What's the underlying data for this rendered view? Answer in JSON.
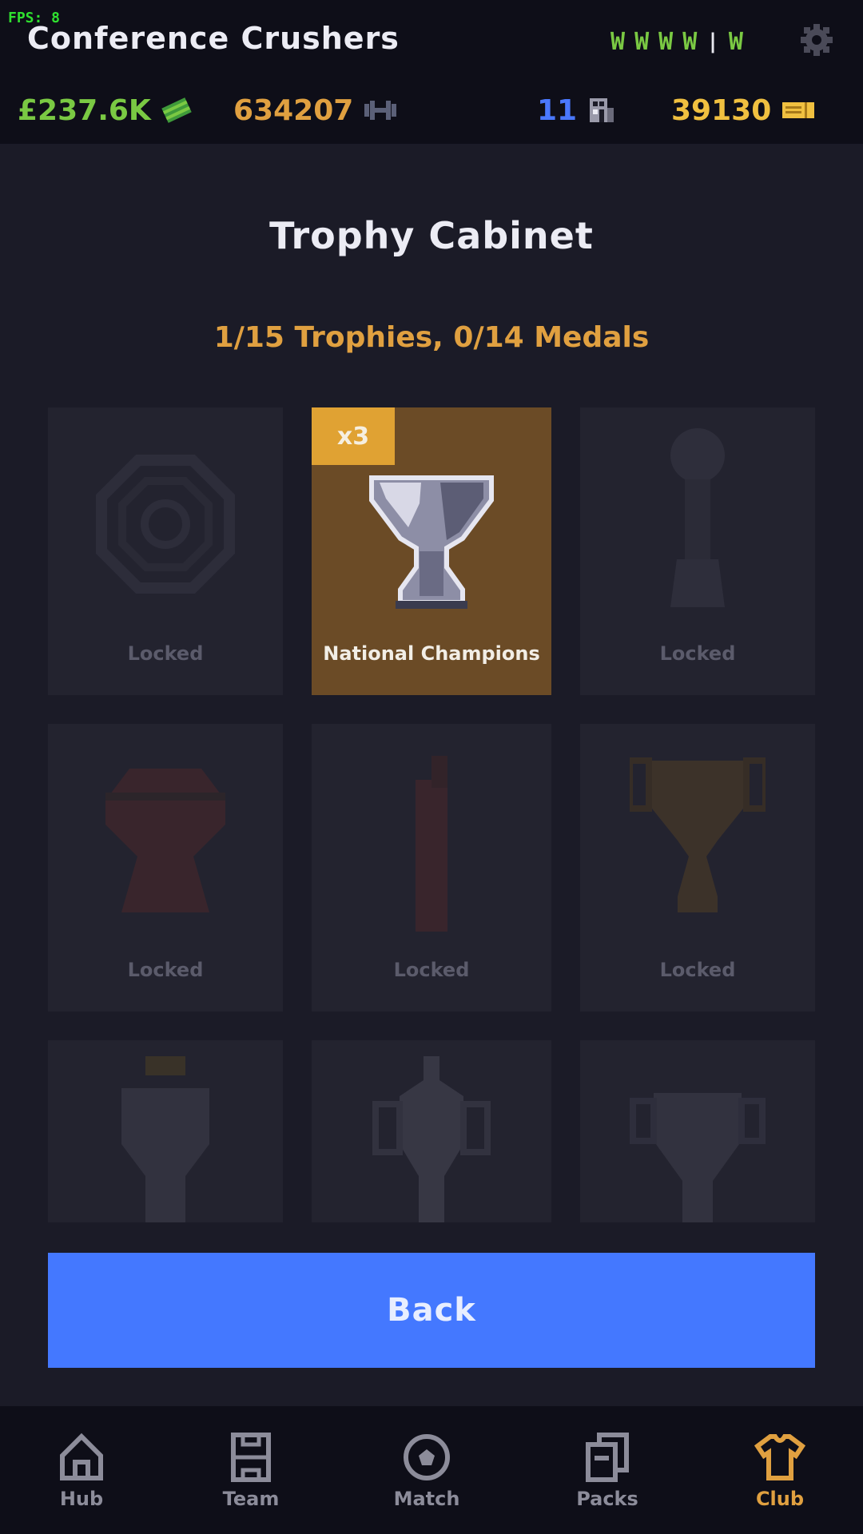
{
  "debug": {
    "fps": "FPS: 8"
  },
  "header": {
    "club_name": "Conference Crushers",
    "form": [
      "W",
      "W",
      "W",
      "W",
      "W"
    ],
    "form_separator": "|",
    "settings_icon": "gear-icon",
    "stats": {
      "money": {
        "value": "£237.6K",
        "icon": "cash-icon",
        "color": "#7ac943"
      },
      "training": {
        "value": "634207",
        "icon": "dumbbell-icon",
        "color": "#e0a040"
      },
      "fans": {
        "value": "11",
        "icon": "building-icon",
        "color": "#4a78ff"
      },
      "tickets": {
        "value": "39130",
        "icon": "ticket-icon",
        "color": "#f0c040"
      }
    }
  },
  "main": {
    "title": "Trophy Cabinet",
    "progress": "1/15 Trophies, 0/14 Medals",
    "trophies": [
      {
        "label": "Locked",
        "unlocked": false
      },
      {
        "label": "National Champions",
        "unlocked": true,
        "count": "x3"
      },
      {
        "label": "Locked",
        "unlocked": false
      },
      {
        "label": "Locked",
        "unlocked": false
      },
      {
        "label": "Locked",
        "unlocked": false
      },
      {
        "label": "Locked",
        "unlocked": false
      },
      {
        "label": "",
        "unlocked": false
      },
      {
        "label": "",
        "unlocked": false
      },
      {
        "label": "",
        "unlocked": false
      }
    ],
    "back_label": "Back"
  },
  "nav": {
    "items": [
      {
        "label": "Hub",
        "icon": "home-icon",
        "active": false
      },
      {
        "label": "Team",
        "icon": "formation-icon",
        "active": false
      },
      {
        "label": "Match",
        "icon": "ball-icon",
        "active": false
      },
      {
        "label": "Packs",
        "icon": "cards-icon",
        "active": false
      },
      {
        "label": "Club",
        "icon": "shirt-icon",
        "active": true
      }
    ]
  },
  "colors": {
    "accent_blue": "#4478ff",
    "gold": "#e0a040",
    "unlocked_card": "#6b4b26",
    "form_win": "#7ac943"
  }
}
